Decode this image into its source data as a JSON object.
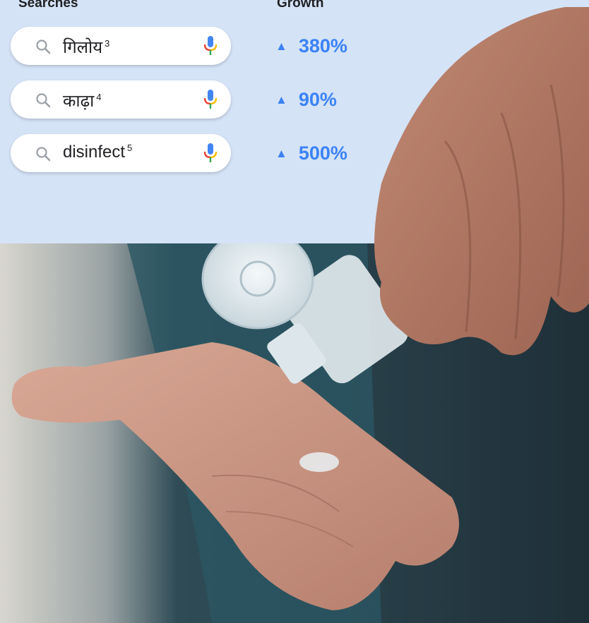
{
  "headers": {
    "searches": "Searches",
    "growth": "Growth"
  },
  "rows": [
    {
      "query": "गिलोय",
      "footnote": "3",
      "growth": "380%"
    },
    {
      "query": "काढ़ा",
      "footnote": "4",
      "growth": "90%"
    },
    {
      "query": "disinfect",
      "footnote": "5",
      "growth": "500%"
    }
  ],
  "growth_marker": "▲",
  "icons": {
    "search": "search-icon",
    "mic": "mic-icon",
    "up": "up-triangle-icon"
  },
  "colors": {
    "panel": "#d5e3f7",
    "growth_text": "#3b82f6",
    "mic_blue": "#4285f4",
    "mic_red": "#ea4335",
    "mic_yellow": "#fbbc05",
    "mic_green": "#34a853"
  }
}
